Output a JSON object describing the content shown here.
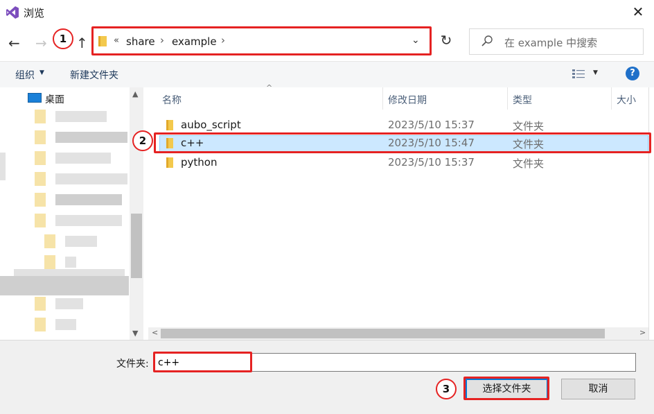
{
  "window": {
    "title": "浏览",
    "close_glyph": "✕"
  },
  "nav": {
    "back_glyph": "←",
    "forward_glyph": "→",
    "up_glyph": "↑",
    "breadcrumb_overflow": "«",
    "breadcrumbs": [
      "share",
      "example"
    ],
    "separator": "›",
    "dropdown_glyph": "⌄",
    "refresh_glyph": "↻",
    "search_placeholder": "在 example 中搜索"
  },
  "command_bar": {
    "organize_label": "组织",
    "organize_caret": "▼",
    "new_folder_label": "新建文件夹",
    "view_caret": "▼",
    "help_label": "?"
  },
  "nav_pane": {
    "items": [
      {
        "label": "桌面",
        "icon": "desktop-icon"
      }
    ],
    "scroll_up_glyph": "▲",
    "scroll_down_glyph": "▼"
  },
  "file_list": {
    "columns": [
      "名称",
      "修改日期",
      "类型",
      "大小"
    ],
    "sort_glyph": "^",
    "rows": [
      {
        "name": "aubo_script",
        "date": "2023/5/10 15:37",
        "type": "文件夹",
        "selected": false
      },
      {
        "name": "c++",
        "date": "2023/5/10 15:47",
        "type": "文件夹",
        "selected": true
      },
      {
        "name": "python",
        "date": "2023/5/10 15:37",
        "type": "文件夹",
        "selected": false
      }
    ],
    "hscroll_left_glyph": "<",
    "hscroll_right_glyph": ">"
  },
  "bottom": {
    "folder_label": "文件夹:",
    "folder_value": "c++",
    "select_button": "选择文件夹",
    "cancel_button": "取消"
  },
  "annotations": {
    "badges": [
      "1",
      "2",
      "3"
    ],
    "color": "#e52222"
  },
  "colors": {
    "selection": "#cce8ff",
    "accent": "#0078d7",
    "help": "#1f70c9",
    "folder": "#f3c94d"
  }
}
